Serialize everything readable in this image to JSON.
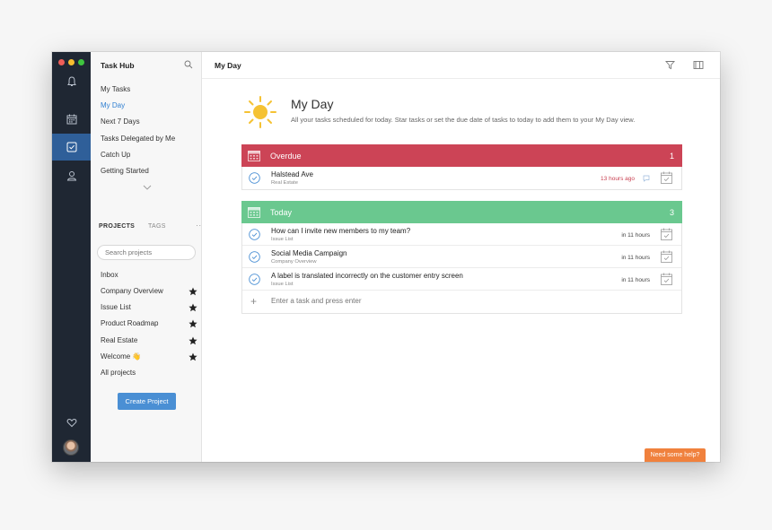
{
  "sidebar": {
    "title": "Task Hub",
    "nav": [
      {
        "label": "My Tasks"
      },
      {
        "label": "My Day"
      },
      {
        "label": "Next 7 Days"
      },
      {
        "label": "Tasks Delegated by Me"
      },
      {
        "label": "Catch Up"
      },
      {
        "label": "Getting Started"
      }
    ],
    "tabs": {
      "projects": "PROJECTS",
      "tags": "TAGS",
      "more": "···"
    },
    "search_placeholder": "Search projects",
    "projects": [
      {
        "label": "Inbox",
        "starred": false
      },
      {
        "label": "Company Overview",
        "starred": true
      },
      {
        "label": "Issue List",
        "starred": true
      },
      {
        "label": "Product Roadmap",
        "starred": true
      },
      {
        "label": "Real Estate",
        "starred": true
      },
      {
        "label": "Welcome 👋",
        "starred": true
      },
      {
        "label": "All projects",
        "starred": false
      }
    ],
    "create_button": "Create Project"
  },
  "main": {
    "title": "My Day",
    "hero": {
      "title": "My Day",
      "subtitle": "All your tasks scheduled for today. Star tasks or set the due date of tasks to today to add them to your My Day view."
    },
    "overdue": {
      "label": "Overdue",
      "count": "1",
      "color": "#cc4456",
      "tasks": [
        {
          "title": "Halstead Ave",
          "project": "Real Estate",
          "time": "13 hours ago"
        }
      ]
    },
    "today": {
      "label": "Today",
      "count": "3",
      "color": "#6ac88f",
      "tasks": [
        {
          "title": "How can I invite new members to my team?",
          "project": "Issue List",
          "time": "in 11 hours"
        },
        {
          "title": "Social Media Campaign",
          "project": "Company Overview",
          "time": "in 11 hours"
        },
        {
          "title": "A label is translated incorrectly on the customer entry screen",
          "project": "Issue List",
          "time": "in 11 hours"
        }
      ],
      "add_placeholder": "Enter a task and press enter"
    }
  },
  "help_button": "Need some help?",
  "colors": {
    "accent": "#2f7fd1",
    "rail": "#1f2733",
    "rail_active": "#2f5f99",
    "help": "#f0813d"
  }
}
